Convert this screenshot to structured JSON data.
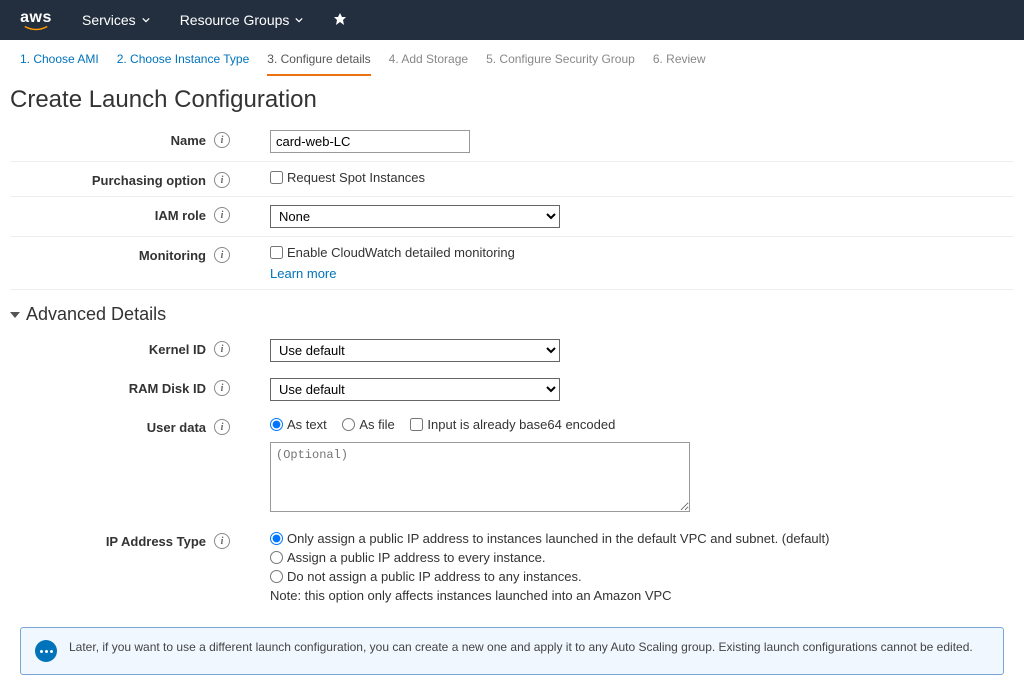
{
  "nav": {
    "logo": "aws",
    "services": "Services",
    "resource_groups": "Resource Groups"
  },
  "steps": [
    {
      "label": "1. Choose AMI",
      "state": "link"
    },
    {
      "label": "2. Choose Instance Type",
      "state": "link"
    },
    {
      "label": "3. Configure details",
      "state": "active"
    },
    {
      "label": "4. Add Storage",
      "state": "inactive"
    },
    {
      "label": "5. Configure Security Group",
      "state": "inactive"
    },
    {
      "label": "6. Review",
      "state": "inactive"
    }
  ],
  "header": "Create Launch Configuration",
  "form": {
    "name_label": "Name",
    "name_value": "card-web-LC",
    "purchasing_label": "Purchasing option",
    "purchasing_checkbox": "Request Spot Instances",
    "iam_label": "IAM role",
    "iam_value": "None",
    "monitoring_label": "Monitoring",
    "monitoring_checkbox": "Enable CloudWatch detailed monitoring",
    "monitoring_link": "Learn more"
  },
  "advanced": {
    "section_title": "Advanced Details",
    "kernel_label": "Kernel ID",
    "kernel_value": "Use default",
    "ramdisk_label": "RAM Disk ID",
    "ramdisk_value": "Use default",
    "userdata_label": "User data",
    "userdata_as_text": "As text",
    "userdata_as_file": "As file",
    "userdata_base64": "Input is already base64 encoded",
    "userdata_placeholder": "(Optional)",
    "ip_label": "IP Address Type",
    "ip_opt1": "Only assign a public IP address to instances launched in the default VPC and subnet. (default)",
    "ip_opt2": "Assign a public IP address to every instance.",
    "ip_opt3": "Do not assign a public IP address to any instances.",
    "ip_note": "Note: this option only affects instances launched into an Amazon VPC"
  },
  "banner": "Later, if you want to use a different launch configuration, you can create a new one and apply it to any Auto Scaling group. Existing launch configurations cannot be edited."
}
